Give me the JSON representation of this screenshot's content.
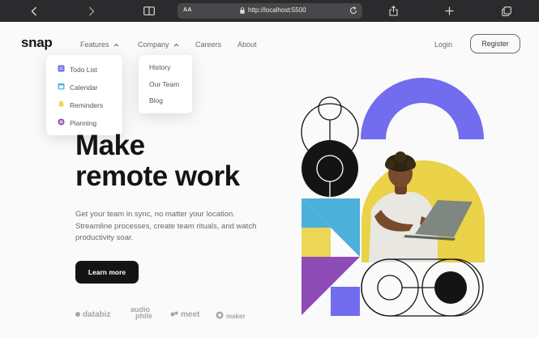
{
  "browser": {
    "text_size_label": "AA",
    "url": "http://localhost:5500"
  },
  "nav": {
    "logo": "snap",
    "features_label": "Features",
    "company_label": "Company",
    "careers_label": "Careers",
    "about_label": "About",
    "login_label": "Login",
    "register_label": "Register"
  },
  "features_menu": {
    "items": [
      {
        "label": "Todo List",
        "icon": "todo-list-icon",
        "color": "#726cee"
      },
      {
        "label": "Calendar",
        "icon": "calendar-icon",
        "color": "#4bb1da"
      },
      {
        "label": "Reminders",
        "icon": "bell-icon",
        "color": "#edd556"
      },
      {
        "label": "Planning",
        "icon": "planning-icon",
        "color": "#8e4cb6"
      }
    ]
  },
  "company_menu": {
    "items": [
      {
        "label": "History"
      },
      {
        "label": "Our Team"
      },
      {
        "label": "Blog"
      }
    ]
  },
  "hero": {
    "headline_line1": "Make",
    "headline_line2": "remote work",
    "subtext": "Get your team in sync, no matter your location. Streamline processes, create team rituals, and watch productivity soar.",
    "cta_label": "Learn more"
  },
  "partners": {
    "databiz": "databiz",
    "audiophile_top": "audio",
    "audiophile_bottom": "phile",
    "meet": "meet",
    "maker": "maker"
  },
  "colors": {
    "dark": "#141414",
    "gray": "#696969",
    "purple": "#726cee",
    "blue": "#4bb1da",
    "yellow": "#edd556",
    "violet": "#8e4cb6"
  }
}
